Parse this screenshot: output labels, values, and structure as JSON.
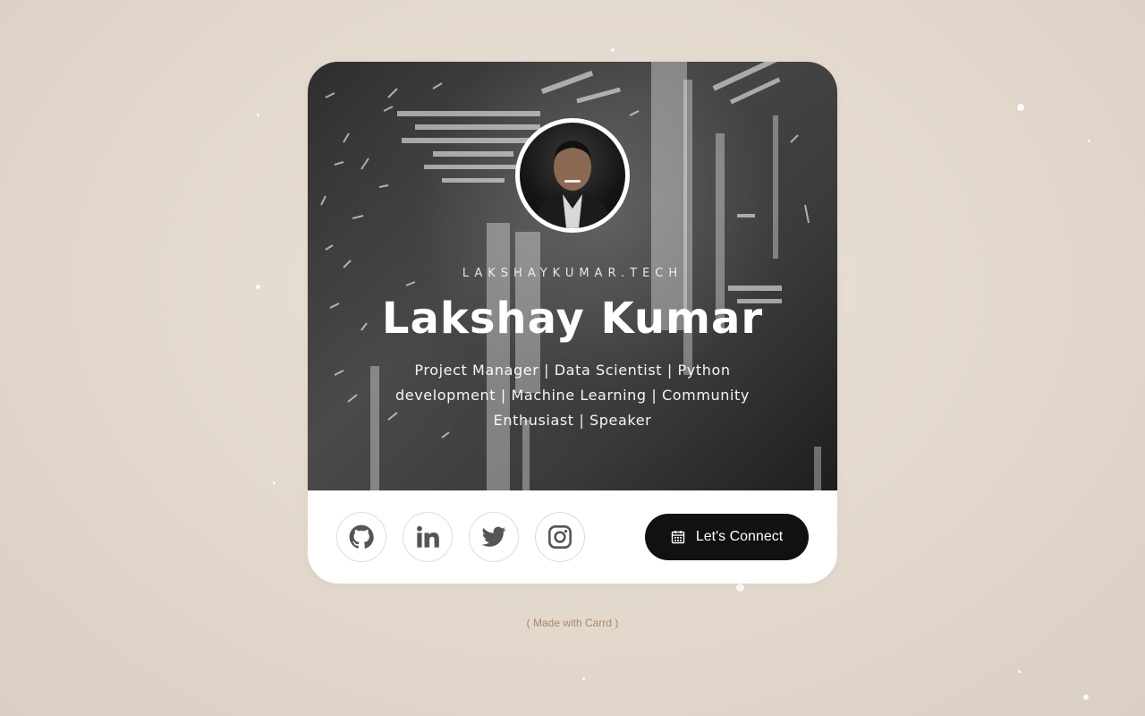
{
  "profile": {
    "domain": "LAKSHAYKUMAR.TECH",
    "name": "Lakshay Kumar",
    "tagline": "Project Manager | Data Scientist | Python development | Machine Learning | Community Enthusiast | Speaker"
  },
  "social": [
    {
      "id": "github",
      "icon": "github-icon"
    },
    {
      "id": "linkedin",
      "icon": "linkedin-icon"
    },
    {
      "id": "twitter",
      "icon": "twitter-icon"
    },
    {
      "id": "instagram",
      "icon": "instagram-icon"
    }
  ],
  "cta": {
    "label": "Let's Connect",
    "icon": "calendar-icon"
  },
  "footer": {
    "text": "( Made with Carrd )"
  },
  "colors": {
    "background": "#e2d8cc",
    "button": "#111111",
    "footer_text": "#a8896a",
    "icon": "#555555"
  }
}
